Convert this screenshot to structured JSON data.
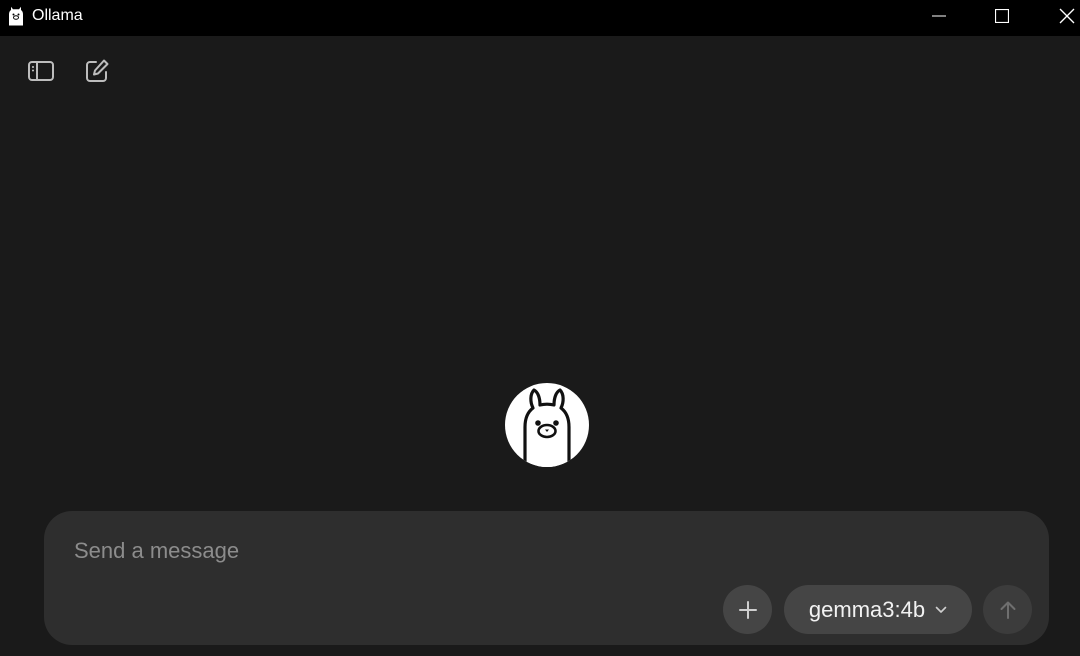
{
  "window": {
    "title": "Ollama",
    "icons": {
      "app": "llama-icon",
      "minimize": "minimize-icon",
      "maximize": "maximize-icon",
      "close": "close-icon"
    }
  },
  "toolbar": {
    "icons": {
      "sidebar_toggle": "sidebar-toggle-icon",
      "new_chat": "new-chat-icon"
    }
  },
  "main": {
    "logo_icon": "ollama-llama-logo"
  },
  "composer": {
    "placeholder": "Send a message",
    "value": "",
    "attach_icon": "plus-icon",
    "model": {
      "selected": "gemma3:4b",
      "icon": "chevron-down-icon"
    },
    "send_icon": "arrow-up-icon"
  },
  "colors": {
    "titlebar": "#000000",
    "background": "#1a1a1a",
    "composer": "#2e2e2e",
    "control": "#454545",
    "send_disabled": "#3c3c3c"
  }
}
